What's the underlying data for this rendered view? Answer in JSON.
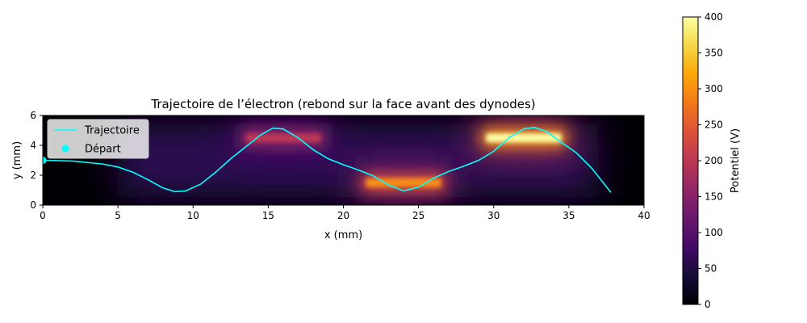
{
  "chart_data": {
    "type": "heatmap",
    "title": "Trajectoire de l’électron (rebond sur la face avant des dynodes)",
    "xlabel": "x (mm)",
    "ylabel": "y (mm)",
    "xlim": [
      0,
      40
    ],
    "ylim": [
      0,
      6
    ],
    "x_ticks": [
      0,
      5,
      10,
      15,
      20,
      25,
      30,
      35,
      40
    ],
    "y_ticks": [
      0,
      2,
      4,
      6
    ],
    "grid": false,
    "colormap": "inferno",
    "heatmap": {
      "background_potential": 60,
      "sources": [
        {
          "x_range": [
            13.5,
            18.5
          ],
          "y_range": [
            4.2,
            4.8
          ],
          "potential": 200
        },
        {
          "x_range": [
            21.5,
            26.5
          ],
          "y_range": [
            1.2,
            1.8
          ],
          "potential": 300
        },
        {
          "x_range": [
            29.5,
            34.5
          ],
          "y_range": [
            4.2,
            4.8
          ],
          "potential": 400
        }
      ]
    },
    "series": [
      {
        "name": "Trajectoire",
        "type": "line",
        "color": "#00ffff",
        "x": [
          0,
          2,
          4,
          5,
          6,
          7,
          8,
          8.8,
          9.5,
          10.5,
          11.5,
          12.5,
          13.5,
          14.5,
          15.3,
          16,
          17,
          18,
          19,
          20,
          21,
          22,
          23,
          24,
          25,
          26,
          27,
          28,
          29,
          30,
          31,
          32,
          32.7,
          33.5,
          34.5,
          35.5,
          36.5,
          37.8
        ],
        "y": [
          3.0,
          2.95,
          2.75,
          2.55,
          2.2,
          1.7,
          1.15,
          0.9,
          0.95,
          1.4,
          2.2,
          3.1,
          3.9,
          4.7,
          5.15,
          5.1,
          4.5,
          3.7,
          3.1,
          2.7,
          2.35,
          1.95,
          1.35,
          0.95,
          1.2,
          1.8,
          2.25,
          2.6,
          3.0,
          3.6,
          4.5,
          5.1,
          5.2,
          4.95,
          4.2,
          3.5,
          2.5,
          0.85
        ]
      },
      {
        "name": "Départ",
        "type": "scatter",
        "color": "#00ffff",
        "x": [
          0
        ],
        "y": [
          3.0
        ]
      }
    ],
    "legend": {
      "placement": "upper-left",
      "entries": [
        {
          "label": "Trajectoire",
          "marker": "line",
          "color": "#00ffff"
        },
        {
          "label": "Départ",
          "marker": "dot",
          "color": "#00ffff"
        }
      ]
    },
    "colorbar": {
      "label": "Potentiel (V)",
      "range": [
        0,
        400
      ],
      "ticks": [
        0,
        50,
        100,
        150,
        200,
        250,
        300,
        350,
        400
      ]
    }
  }
}
